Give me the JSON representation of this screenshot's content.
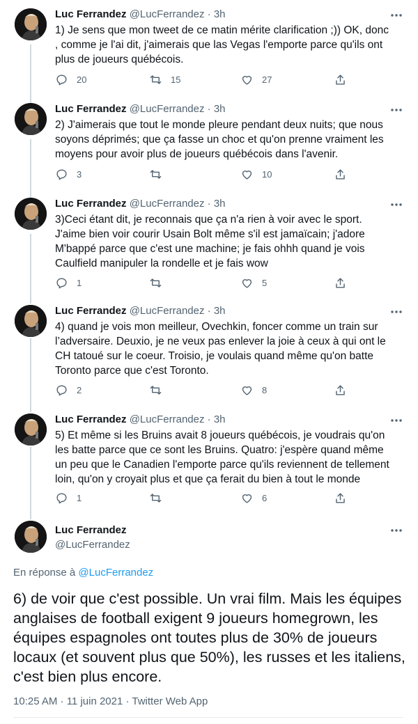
{
  "thread": [
    {
      "name": "Luc Ferrandez",
      "handle": "@LucFerrandez",
      "time": "3h",
      "text": "1) Je sens que mon tweet de ce matin mérite clarification ;)) OK, donc\n, comme je l'ai dit, j'aimerais que las Vegas l'emporte parce qu'ils ont\nplus de joueurs québécois.",
      "replies": "20",
      "retweets": "15",
      "likes": "27"
    },
    {
      "name": "Luc Ferrandez",
      "handle": "@LucFerrandez",
      "time": "3h",
      "text": "2) J'aimerais que tout le monde pleure pendant deux nuits; que nous\nsoyons déprimés; que ça fasse un choc et qu'on prenne vraiment les\nmoyens pour avoir plus de joueurs québécois dans l'avenir.",
      "replies": "3",
      "retweets": "",
      "likes": "10"
    },
    {
      "name": "Luc Ferrandez",
      "handle": "@LucFerrandez",
      "time": "3h",
      "text": "3)Ceci étant dit, je  reconnais que ça n'a rien à voir avec le sport.\nJ'aime bien voir courir Usain Bolt même s'il est jamaïcain; j'adore\nM'bappé parce que c'est une machine; je fais ohhh quand je vois\nCaulfield manipuler la rondelle et je fais wow",
      "replies": "1",
      "retweets": "",
      "likes": "5"
    },
    {
      "name": "Luc Ferrandez",
      "handle": "@LucFerrandez",
      "time": "3h",
      "text": "4) quand je vois mon meilleur, Ovechkin, foncer comme un train sur\nl’adversaire. Deuxio, je ne veux pas enlever la joie à ceux à qui ont le\nCH tatoué sur le coeur. Troisio, je voulais quand même qu'on batte\nToronto parce que c'est Toronto.",
      "replies": "2",
      "retweets": "",
      "likes": "8"
    },
    {
      "name": "Luc Ferrandez",
      "handle": "@LucFerrandez",
      "time": "3h",
      "text": "5) Et même si les Bruins avait 8 joueurs québécois, je voudrais qu'on\nles batte parce que ce sont les Bruins. Quatro: j'espère quand même\nun peu que le Canadien l'emporte parce qu'ils reviennent de tellement\nloin, qu'on y croyait plus et que ça ferait du bien à tout le monde",
      "replies": "1",
      "retweets": "",
      "likes": "6"
    }
  ],
  "main": {
    "name": "Luc Ferrandez",
    "handle": "@LucFerrandez",
    "reply_prefix": "En réponse à",
    "reply_handle": "@LucFerrandez",
    "text": "6) de voir que c'est possible. Un vrai film. Mais les équipes anglaises de football exigent 9 joueurs homegrown, les équipes espagnoles ont toutes plus de 30% de joueurs locaux (et souvent plus que 50%), les russes et les italiens, c'est bien plus encore.",
    "meta": "10:25 AM · 11 juin 2021 · Twitter Web App"
  },
  "colors": {
    "accent": "#1d9bf0",
    "muted": "#536471",
    "text": "#0f1419",
    "thread_line": "#cfd9de"
  },
  "icons": [
    "reply-icon",
    "retweet-icon",
    "like-icon",
    "share-icon",
    "more-icon"
  ]
}
